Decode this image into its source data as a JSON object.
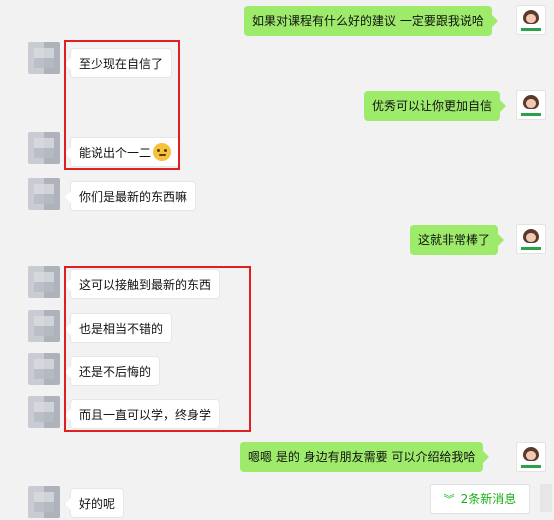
{
  "messages": [
    {
      "side": "right",
      "text": "如果对课程有什么好的建议  一定要跟我说哈"
    },
    {
      "side": "left",
      "text": "至少现在自信了"
    },
    {
      "side": "right",
      "text": "优秀可以让你更加自信"
    },
    {
      "side": "left",
      "text": "能说出个一二"
    },
    {
      "side": "left",
      "text": "你们是最新的东西嘛"
    },
    {
      "side": "right",
      "text": "这就非常棒了"
    },
    {
      "side": "left",
      "text": "这可以接触到最新的东西"
    },
    {
      "side": "left",
      "text": "也是相当不错的"
    },
    {
      "side": "left",
      "text": "还是不后悔的"
    },
    {
      "side": "left",
      "text": "而且一直可以学，终身学"
    },
    {
      "side": "right",
      "text": "嗯嗯  是的   身边有朋友需要  可以介绍给我哈"
    },
    {
      "side": "left",
      "text": "好的呢"
    }
  ],
  "new_messages": {
    "label": "2条新消息",
    "icon": "double-chevron-down-icon"
  },
  "colors": {
    "right_bubble": "#9eea6a",
    "left_bubble": "#ffffff",
    "highlight_box": "#e02020",
    "accent": "#1aad19"
  }
}
